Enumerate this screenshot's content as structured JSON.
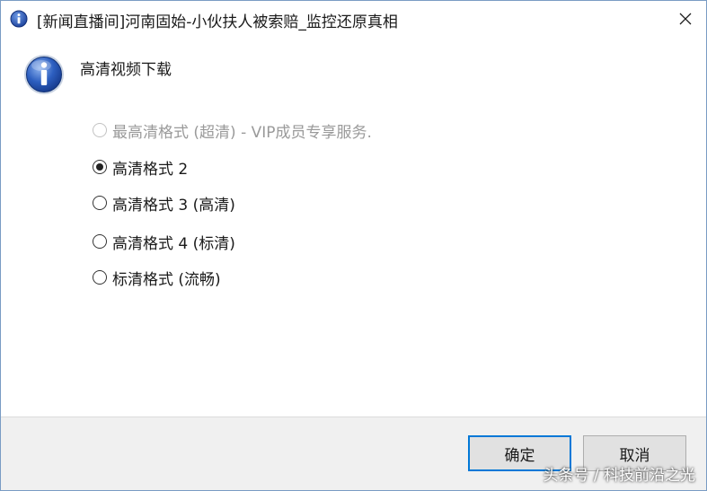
{
  "window": {
    "title": "[新闻直播间]河南固始-小伙扶人被索赔_监控还原真相",
    "title_icon": "info-icon",
    "close_icon": "close-icon"
  },
  "dialog": {
    "icon": "info-icon",
    "heading": "高清视频下载",
    "selected_option_index": 1,
    "options": [
      {
        "label": "最高清格式 (超清) - VIP成员专享服务.",
        "enabled": false,
        "selected": false
      },
      {
        "label": "高清格式 2",
        "enabled": true,
        "selected": true
      },
      {
        "label": "高清格式 3 (高清)",
        "enabled": true,
        "selected": false
      },
      {
        "label": "高清格式 4 (标清)",
        "enabled": true,
        "selected": false
      },
      {
        "label": "标清格式 (流畅)",
        "enabled": true,
        "selected": false
      }
    ]
  },
  "buttons": {
    "ok_label": "确定",
    "cancel_label": "取消"
  },
  "watermark": {
    "text": "头条号 / 科技前沿之光"
  },
  "colors": {
    "accent": "#0078d7",
    "info_icon_blue": "#1e4fa8",
    "footer_bg": "#f0f0f0",
    "disabled_text": "#9a9a9a"
  }
}
